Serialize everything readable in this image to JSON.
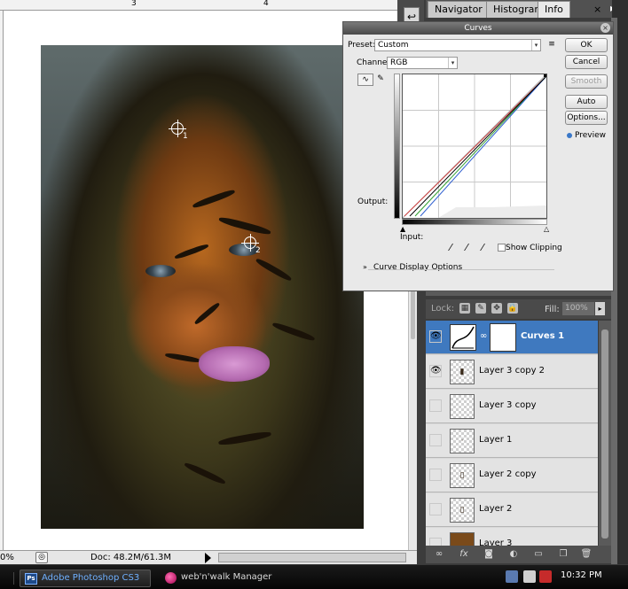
{
  "app": {
    "name": "Adobe Photoshop CS3",
    "collapse_glyph": "↩"
  },
  "rulers": {
    "top_labels": [
      "3",
      "4"
    ]
  },
  "canvas": {
    "sampler_points": [
      "1",
      "2"
    ]
  },
  "status_bar": {
    "zoom": "0%",
    "doc_info": "Doc: 48.2M/61.3M"
  },
  "panels": {
    "tabs": [
      "Navigator",
      "Histogram",
      "Info"
    ],
    "active_tab": "Info",
    "close_glyph": "×",
    "menu_glyph": "▸≡"
  },
  "curves": {
    "title": "Curves",
    "preset_label": "Preset:",
    "preset_value": "Custom",
    "channel_label": "Channel:",
    "channel_value": "RGB",
    "output_label": "Output:",
    "input_label": "Input:",
    "show_clipping_label": "Show Clipping",
    "curve_display_options_label": "Curve Display Options",
    "buttons": {
      "ok": "OK",
      "cancel": "Cancel",
      "smooth": "Smooth",
      "auto": "Auto",
      "options": "Options..."
    },
    "preview_label": "Preview",
    "curve_colors": {
      "red": "#d04040",
      "green": "#30a030",
      "blue": "#3060d0",
      "rgb": "#000000"
    }
  },
  "layers": {
    "lock_label": "Lock:",
    "fill_label": "Fill:",
    "fill_value": "100%",
    "items": [
      {
        "name": "Curves 1",
        "visible": true,
        "selected": true
      },
      {
        "name": "Layer 3 copy 2",
        "visible": true,
        "selected": false
      },
      {
        "name": "Layer 3 copy",
        "visible": false,
        "selected": false
      },
      {
        "name": "Layer 1",
        "visible": false,
        "selected": false
      },
      {
        "name": "Layer 2 copy",
        "visible": false,
        "selected": false
      },
      {
        "name": "Layer 2",
        "visible": false,
        "selected": false
      },
      {
        "name": "Layer 3",
        "visible": false,
        "selected": false
      }
    ],
    "bottom_icons": [
      "link-icon",
      "fx-icon",
      "mask-icon",
      "adjustment-icon",
      "group-icon",
      "new-layer-icon",
      "trash-icon"
    ],
    "fx_glyph": "fx"
  },
  "taskbar": {
    "tasks": [
      "Adobe Photoshop CS3",
      "web'n'walk Manager"
    ],
    "ps_badge": "Ps",
    "clock": "10:32 PM"
  }
}
